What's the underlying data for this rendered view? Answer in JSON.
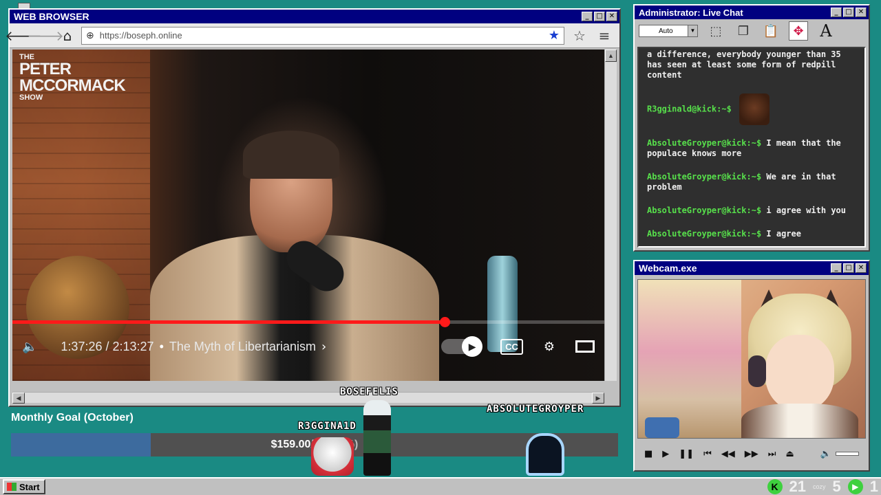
{
  "browser": {
    "title": "WEB BROWSER",
    "url": "https://boseph.online",
    "icons": {
      "back": "arrow-left-icon",
      "forward": "arrow-right-icon",
      "home": "home-icon",
      "site": "globe-icon",
      "bookmark": "star-filled-icon",
      "favorites": "star-outline-icon",
      "menu": "hamburger-icon"
    }
  },
  "video": {
    "show_logo_small_top": "THE",
    "show_logo_line1": "PETER",
    "show_logo_line2": "MCCORMACK",
    "show_logo_small_bottom": "SHOW",
    "current_time": "1:37:26",
    "duration": "2:13:27",
    "time_separator": " / ",
    "separator": "•",
    "title": "The Myth of Libertarianism",
    "progress_fraction": 0.73,
    "cc_label": "CC",
    "accent_color": "#ff1a1a"
  },
  "chat": {
    "title": "Administrator: Live Chat",
    "select_value": "Auto",
    "messages": [
      {
        "handle": "",
        "text": "a difference, everybody younger than 35 has seen at least some form of redpill content"
      },
      {
        "handle": "R3gginald@kick:~$",
        "text": "",
        "emote": true
      },
      {
        "handle": "AbsoluteGroyper@kick:~$",
        "text": "I mean that the populace knows more"
      },
      {
        "handle": "AbsoluteGroyper@kick:~$",
        "text": "We are in that problem"
      },
      {
        "handle": "AbsoluteGroyper@kick:~$",
        "text": "i agree with you"
      },
      {
        "handle": "AbsoluteGroyper@kick:~$",
        "text": "I agree"
      }
    ],
    "handle_color": "#57e04b"
  },
  "webcam": {
    "title": "Webcam.exe"
  },
  "goal": {
    "title": "Monthly Goal (October)",
    "amount_text": "$159.00/$7",
    "amount_tail": "(23%)",
    "progress_fraction": 0.23
  },
  "avatars": {
    "names": [
      "BOSEFELIS",
      "R3GGINA1D",
      "ABSOLUTEGROYPER"
    ]
  },
  "taskbar": {
    "start_label": "Start",
    "tray_count_1": "21",
    "tray_small": "cozy",
    "tray_count_2": "5",
    "tray_count_3": "1",
    "kick_label": "K"
  },
  "colors": {
    "desktop": "#1a8a83",
    "titlebar": "#000080",
    "goal_fill": "#3d6b9e"
  }
}
